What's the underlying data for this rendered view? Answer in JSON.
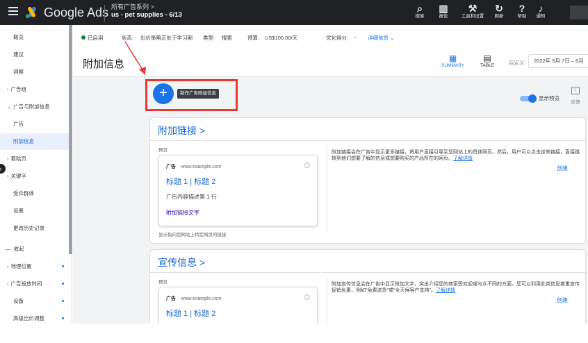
{
  "topbar": {
    "brand": "Google Ads",
    "account_path": "所有广告系列 >",
    "account_name": "us - pet supplies - 6/13",
    "tools": [
      {
        "icon": "search-icon",
        "label": "搜索"
      },
      {
        "icon": "reports-icon",
        "label": "报告"
      },
      {
        "icon": "tools-icon",
        "label": "工具和设置"
      },
      {
        "icon": "refresh-icon",
        "label": "刷新"
      },
      {
        "icon": "help-icon",
        "label": "帮助"
      },
      {
        "icon": "bell-icon",
        "label": "通知"
      }
    ]
  },
  "sidebar": {
    "items": [
      {
        "label": "概览"
      },
      {
        "label": "建议"
      },
      {
        "label": "洞察"
      },
      {
        "label": "广告组"
      },
      {
        "label": "广告与附加信息"
      },
      {
        "label": "广告"
      },
      {
        "label": "附加信息"
      },
      {
        "label": "着陆页"
      },
      {
        "label": "关键字"
      },
      {
        "label": "受众群体"
      },
      {
        "label": "设置"
      },
      {
        "label": "更改历史记录"
      },
      {
        "label": "收起"
      },
      {
        "label": "地理位置"
      },
      {
        "label": "广告投放时间"
      },
      {
        "label": "设备"
      },
      {
        "label": "高级出价调整"
      }
    ]
  },
  "status": {
    "state": "已启用",
    "status_label": "状态:",
    "status_value": "出价策略正处于学习期",
    "type_label": "类型:",
    "type_value": "搜索",
    "budget_label": "预算:",
    "budget_value": "US$100.00/天",
    "opt_label": "优化得分:",
    "opt_value": "–",
    "details_link": "详细信息 ⌄"
  },
  "header": {
    "title": "附加信息",
    "summary_label": "SUMMARY",
    "table_label": "TABLE",
    "custom_label": "自定义",
    "date_range": "2022年 5月 7日 – 6月"
  },
  "toolbar": {
    "fab_symbol": "+",
    "fab_tooltip": "制作广告附加信息",
    "preview_toggle": "显示预览",
    "feedback_label": "反馈"
  },
  "cards": [
    {
      "title": "附加链接 >",
      "preview_label": "预览",
      "ad_label": "广告",
      "ad_url": "· www.example.com",
      "headline": "标题 1 | 标题 2",
      "description": "广告内容描述第 1 行",
      "sitelink_text": "附加链接文字",
      "text": "附加链接会在广告中显示更多链接，将用户直接引导至您网站上的具体网页。然后，用户可以点击这些链接，直接跳转到他们想要了解的信息或想要购买的产品所在的网页。",
      "learn_more": "了解详情",
      "create": "创建",
      "footer": "显示指向您网站上特定网页的链接"
    },
    {
      "title": "宣传信息 >",
      "preview_label": "预览",
      "ad_label": "广告",
      "ad_url": "· www.example.com",
      "headline": "标题 1 | 标题 2",
      "text": "附加宣传信息会在广告中显示附加文字，突出介绍您的商家受欢迎或与众不同的方面。您可以利用此类信息着重宣传促销优惠，例如\"免费送货\"或\"全天候客户支持\"。",
      "learn_more": "了解详情",
      "create": "创建"
    }
  ],
  "colors": {
    "brand_blue": "#1a73e8",
    "highlight_red": "#e53935",
    "topbar": "#202124",
    "status_green": "#188038"
  }
}
